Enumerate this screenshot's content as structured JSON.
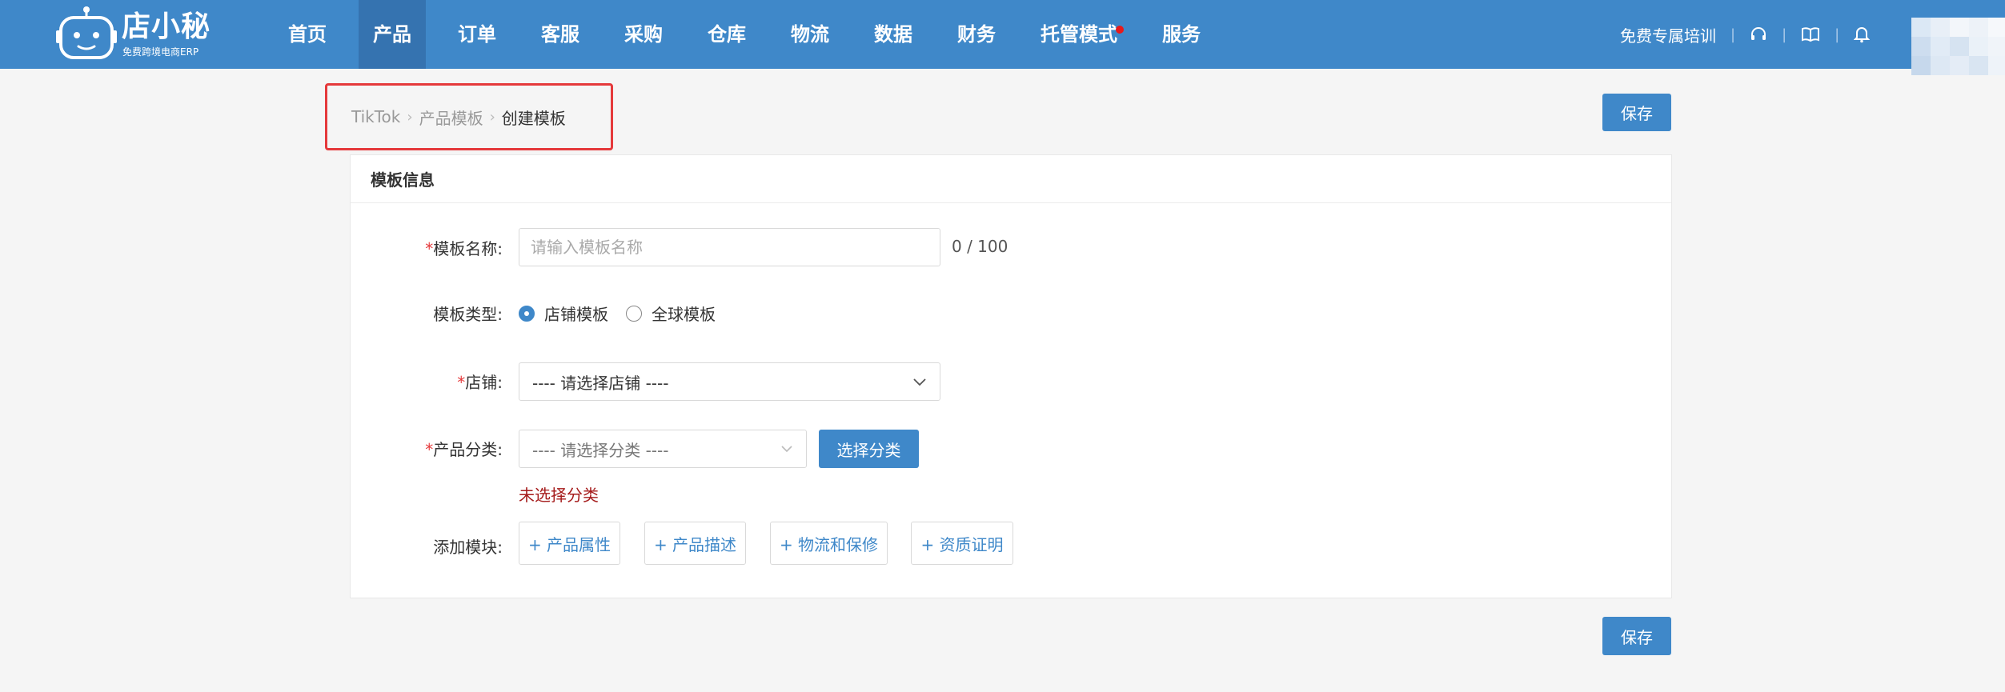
{
  "colors": {
    "brand": "#3f88c9",
    "nav_active": "#3573b0",
    "highlight_border": "#e5393b",
    "required": "#e5393b",
    "error": "#a51b1b",
    "notification_dot": "#e8191b"
  },
  "logo": {
    "name": "店小秘",
    "tagline": "免费跨境电商ERP",
    "icon": "robot-icon"
  },
  "nav": {
    "items": [
      {
        "label": "首页",
        "active": false
      },
      {
        "label": "产品",
        "active": true
      },
      {
        "label": "订单",
        "active": false
      },
      {
        "label": "客服",
        "active": false
      },
      {
        "label": "采购",
        "active": false
      },
      {
        "label": "仓库",
        "active": false
      },
      {
        "label": "物流",
        "active": false
      },
      {
        "label": "数据",
        "active": false
      },
      {
        "label": "财务",
        "active": false
      },
      {
        "label": "托管模式",
        "active": false,
        "badge_dot": true
      },
      {
        "label": "服务",
        "active": false
      }
    ]
  },
  "topbar_right": {
    "training_link": "免费专属培训",
    "separator": "|",
    "icons": [
      "headset-icon",
      "book-icon",
      "bell-icon"
    ]
  },
  "breadcrumb": {
    "items": [
      "TikTok",
      "产品模板",
      "创建模板"
    ],
    "separator": "›"
  },
  "actions": {
    "save_label": "保存"
  },
  "card": {
    "title": "模板信息"
  },
  "form": {
    "template_name": {
      "label": "模板名称:",
      "required_mark": "*",
      "placeholder": "请输入模板名称",
      "value": "",
      "counter": "0 / 100"
    },
    "template_type": {
      "label": "模板类型:",
      "options": [
        "店铺模板",
        "全球模板"
      ],
      "selected": "店铺模板"
    },
    "shop": {
      "label": "店铺:",
      "required_mark": "*",
      "value": "---- 请选择店铺 ----"
    },
    "category": {
      "label": "产品分类:",
      "required_mark": "*",
      "value": "---- 请选择分类 ----",
      "button": "选择分类",
      "error": "未选择分类"
    },
    "modules": {
      "label": "添加模块:",
      "buttons": [
        "+ 产品属性",
        "+ 产品描述",
        "+ 物流和保修",
        "+ 资质证明"
      ]
    }
  }
}
